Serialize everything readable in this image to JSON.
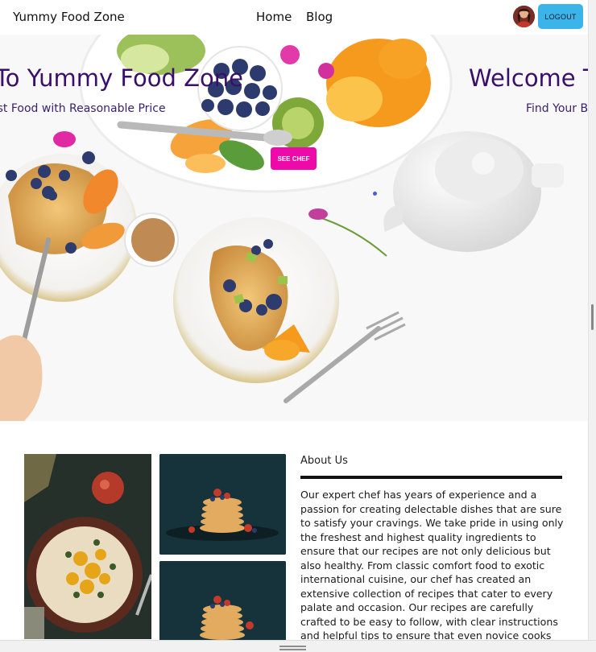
{
  "navbar": {
    "brand": "Yummy Food Zone",
    "links": [
      {
        "label": "Home"
      },
      {
        "label": "Blog"
      }
    ],
    "logout_label": "LOGOUT",
    "accent": "#3bb4ea"
  },
  "hero": {
    "slides": [
      {
        "title": "To Yummy Food Zone",
        "subtitle": "est Food with Reasonable Price"
      },
      {
        "title": "Welcome T",
        "subtitle": "Find Your B"
      }
    ],
    "button_label": "SEE CHEF",
    "button_color": "#ee0aa9",
    "title_color": "#3a0f6b"
  },
  "about": {
    "title": "About Us",
    "body": "Our expert chef has years of experience and a passion for creating delectable dishes that are sure to satisfy your cravings. We take pride in using only the freshest and highest quality ingredients to ensure that our recipes are not only delicious but also healthy. From classic comfort food to exotic international cuisine, our chef has created an extensive collection of recipes that cater to every palate and occasion. Our recipes are carefully crafted to be easy to follow, with clear instructions and helpful tips to ensure that even novice cooks"
  },
  "icons": {
    "avatar": "user-avatar",
    "resize": "resize-handle-icon"
  }
}
